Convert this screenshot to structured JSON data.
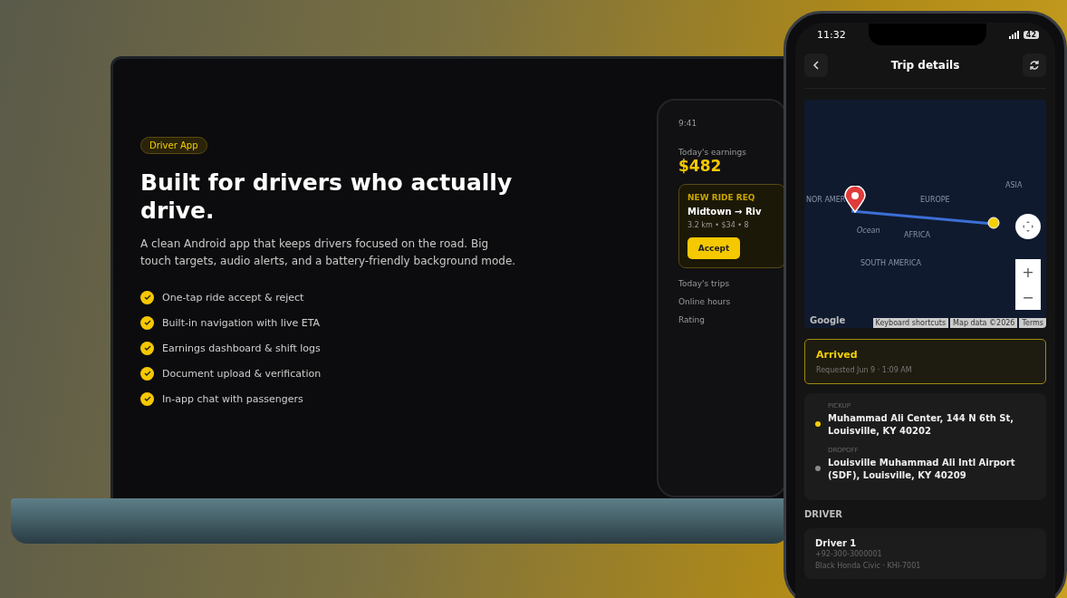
{
  "laptop": {
    "badge": "Driver App",
    "headline": "Built for drivers who actually drive.",
    "description": "A clean Android app that keeps drivers focused on the road. Big touch targets, audio alerts, and a battery-friendly background mode.",
    "features": [
      {
        "text": "One-tap ride accept & reject",
        "checked": true
      },
      {
        "text": "Built-in navigation with live ETA",
        "checked": true
      },
      {
        "text": "Earnings dashboard & shift logs",
        "checked": true
      },
      {
        "text": "Document upload & verification",
        "checked": true
      },
      {
        "text": "In-app chat with passengers",
        "checked": true
      }
    ],
    "mini_phone": {
      "time": "9:41",
      "earnings_label": "Today's earnings",
      "earnings": "$482",
      "request_title": "NEW RIDE REQ",
      "route": "Midtown → Riv",
      "details": "3.2 km • $34 • 8",
      "accept": "Accept",
      "stats": [
        "Today's trips",
        "Online hours",
        "Rating"
      ]
    }
  },
  "phone": {
    "status": {
      "time": "11:32",
      "battery": "42"
    },
    "title": "Trip details",
    "map": {
      "labels": [
        {
          "text": "NOR AMER",
          "kind": "continent"
        },
        {
          "text": "EUROPE",
          "kind": "continent"
        },
        {
          "text": "ASIA",
          "kind": "continent"
        },
        {
          "text": "Ocean",
          "kind": "water"
        },
        {
          "text": "AFRICA",
          "kind": "continent"
        },
        {
          "text": "SOUTH AMERICA",
          "kind": "continent"
        }
      ],
      "logo": "Google",
      "attribution": [
        "Keyboard shortcuts",
        "Map data ©2026",
        "Terms"
      ],
      "zoom_in": "+",
      "zoom_out": "−"
    },
    "status_card": {
      "status": "Arrived",
      "requested": "Requested Jun 9 · 1:09 AM"
    },
    "stops": [
      {
        "label": "PICKUP",
        "address": "Muhammad Ali Center, 144 N 6th St, Louisville, KY 40202",
        "color": "#f5d000"
      },
      {
        "label": "DROPOFF",
        "address": "Louisville Muhammad Ali Intl Airport (SDF), Louisville, KY 40209",
        "color": "#8a8a8a"
      }
    ],
    "driver_heading": "DRIVER",
    "driver": {
      "name": "Driver 1",
      "phone": "+92-300-3000001",
      "vehicle": "Black Honda Civic · KHI-7001"
    }
  }
}
